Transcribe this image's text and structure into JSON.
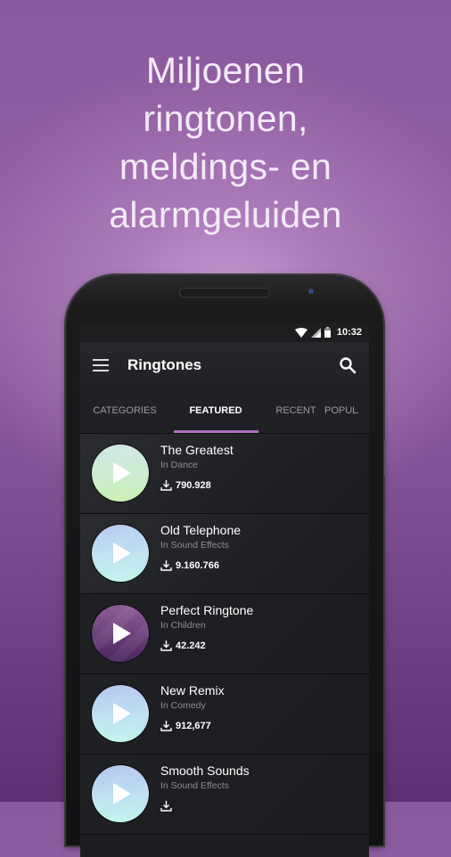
{
  "headline": {
    "lines": [
      "Miljoenen",
      "ringtonen,",
      "meldings- en",
      "alarmgeluiden"
    ]
  },
  "status_bar": {
    "time": "10:32",
    "icons": [
      "wifi-icon",
      "signal-icon",
      "battery-icon"
    ]
  },
  "app_bar": {
    "title": "Ringtones",
    "menu_icon": "menu-icon",
    "search_icon": "search-icon"
  },
  "tabs": [
    {
      "label": "CATEGORIES",
      "active": false
    },
    {
      "label": "FEATURED",
      "active": true
    },
    {
      "label": "RECENT",
      "active": false
    },
    {
      "label": "POPULAR",
      "active": false
    }
  ],
  "colors": {
    "accent": "#b36ec4",
    "background_purple": "#8a5aa0",
    "screen_bg": "#1c1d20"
  },
  "ringtones": [
    {
      "title": "The Greatest",
      "category": "In Dance",
      "downloads": "790.928",
      "thumb_colors": [
        "#cfe7e7",
        "#c8efb5"
      ]
    },
    {
      "title": "Old Telephone",
      "category": "In Sound Effects",
      "downloads": "9.160.766",
      "thumb_colors": [
        "#b9cdf2",
        "#c2f3ee"
      ]
    },
    {
      "title": "Perfect Ringtone",
      "category": "In Children",
      "downloads": "42.242",
      "thumb_colors": [
        "#8e5d98",
        "#4a2560"
      ]
    },
    {
      "title": "New Remix",
      "category": "In Comedy",
      "downloads": "912,677",
      "thumb_colors": [
        "#b7c8f2",
        "#c0f3ee"
      ]
    },
    {
      "title": "Smooth Sounds",
      "category": "In Sound Effects",
      "downloads": "",
      "thumb_colors": [
        "#b7c8f2",
        "#c0f3ee"
      ]
    }
  ]
}
